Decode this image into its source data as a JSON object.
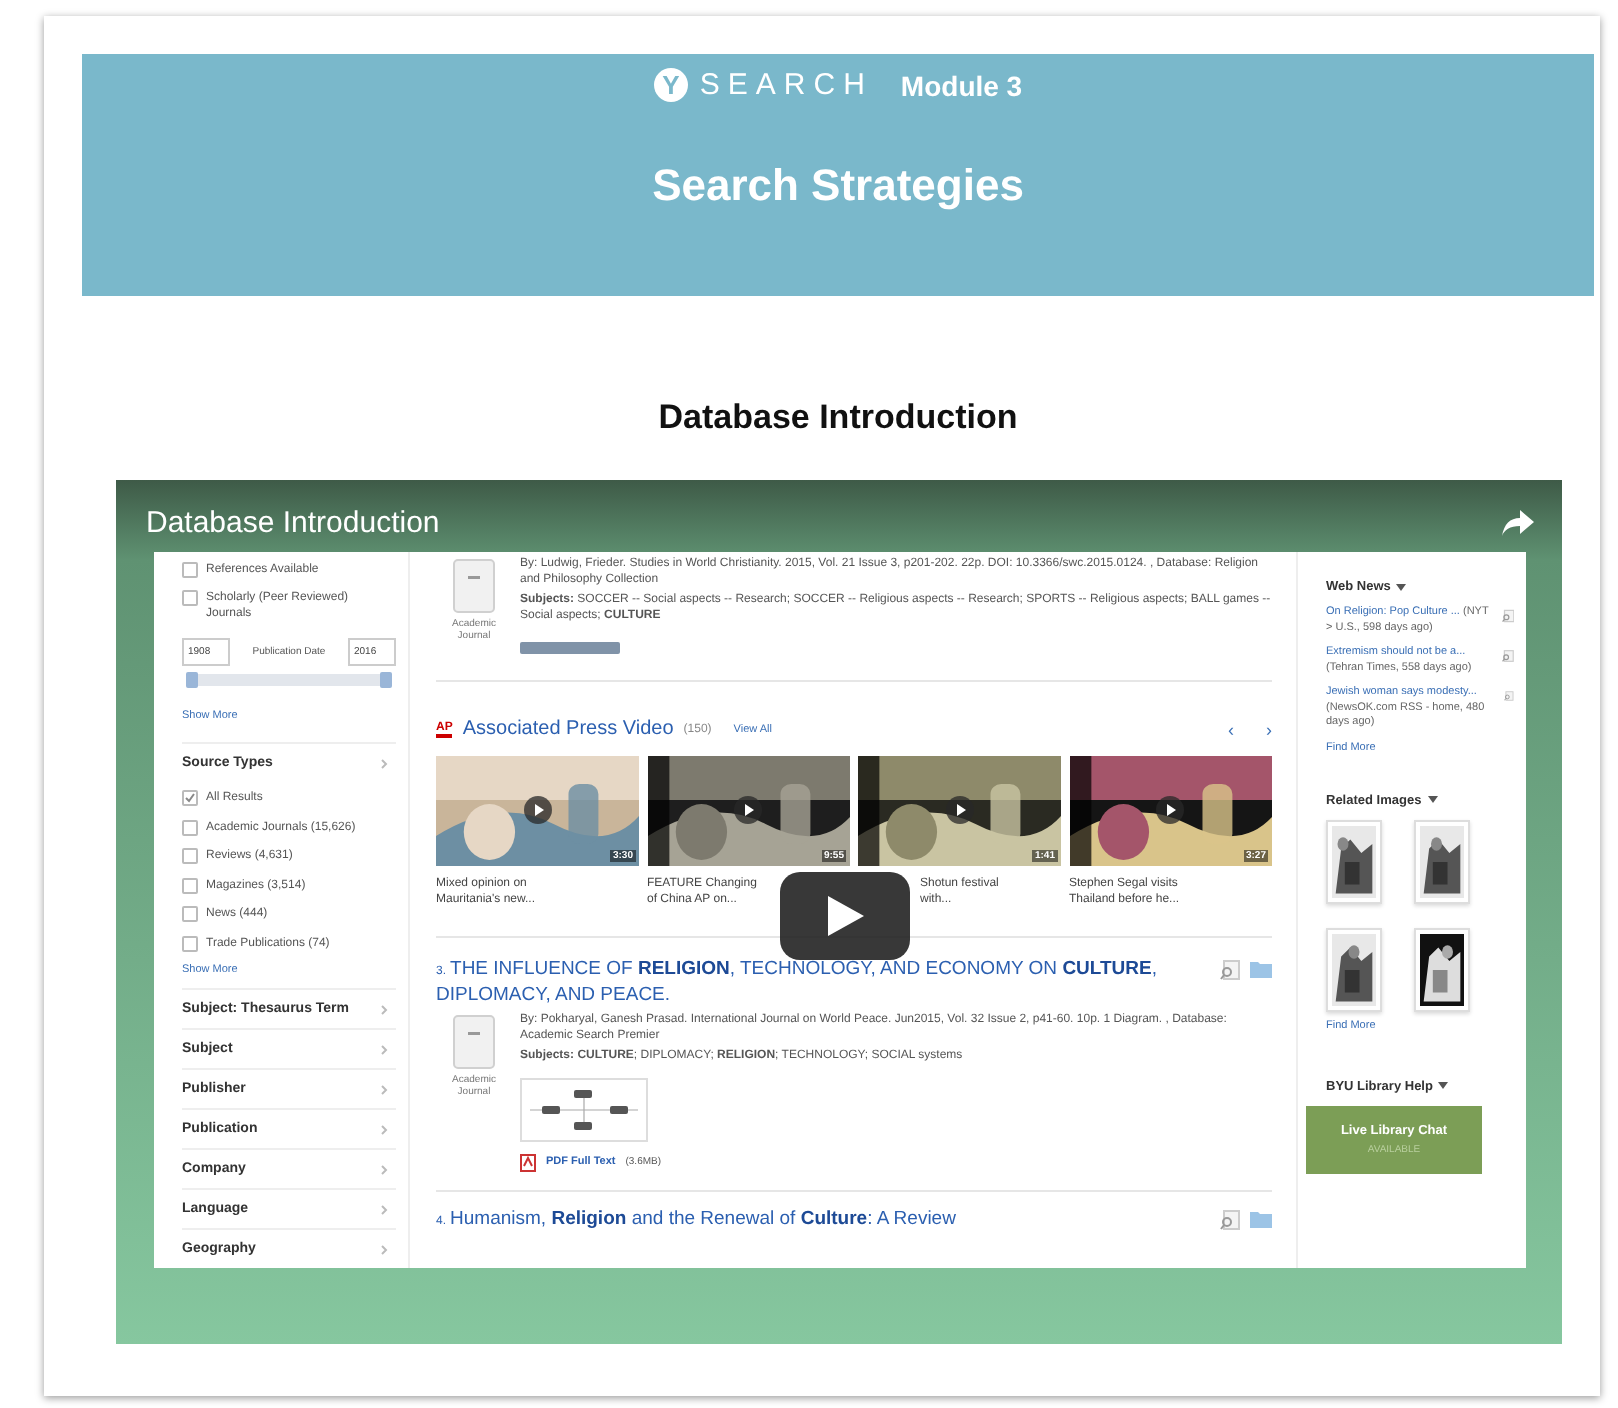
{
  "header": {
    "logo_letter": "Y",
    "brand": "SEARCH",
    "module": "Module 3",
    "title": "Search Strategies"
  },
  "section_heading": "Database Introduction",
  "video": {
    "title": "Database Introduction",
    "screen": {
      "sidebar": {
        "limiters": [
          {
            "label": "References Available",
            "checked": false
          },
          {
            "label": "Scholarly (Peer Reviewed) Journals",
            "checked": false
          }
        ],
        "date": {
          "from": "1908",
          "label": "Publication Date",
          "to": "2016",
          "slider": {
            "level": 1
          }
        },
        "show_more": "Show More",
        "source_types": {
          "title": "Source Types",
          "items": [
            {
              "label": "All Results",
              "checked": true
            },
            {
              "label": "Academic Journals (15,626)",
              "checked": false
            },
            {
              "label": "Reviews (4,631)",
              "checked": false
            },
            {
              "label": "Magazines (3,514)",
              "checked": false
            },
            {
              "label": "News (444)",
              "checked": false
            },
            {
              "label": "Trade Publications (74)",
              "checked": false
            }
          ],
          "show_more": "Show More"
        },
        "facets": [
          "Subject: Thesaurus Term",
          "Subject",
          "Publisher",
          "Publication",
          "Company",
          "Language",
          "Geography"
        ]
      },
      "previous_result": {
        "type_label": "Academic Journal",
        "meta": "By: Ludwig, Frieder. Studies in World Christianity. 2015, Vol. 21 Issue 3, p201-202. 22p. DOI: 10.3366/swc.2015.0124. , Database: Religion and Philosophy Collection",
        "subjects": "**Subjects:** SOCCER -- Social aspects -- Research; SOCCER -- Religious aspects -- Research; SPORTS -- Religious aspects; BALL games -- Social aspects; **CULTURE**"
      },
      "ap_video": {
        "logo": "AP",
        "title": "Associated Press Video",
        "count": "(150)",
        "view_all": "View All",
        "prev": "‹",
        "next": "›",
        "videos": [
          {
            "duration": "3:30",
            "caption": [
              "Mixed opinion on",
              "Mauritania's new..."
            ],
            "partly_hidden": false
          },
          {
            "duration": "9:55",
            "caption": [
              "FEATURE Changing",
              "of China AP on..."
            ],
            "partly_hidden": false
          },
          {
            "duration": "1:41",
            "caption": [
              "Shotun festival",
              "with..."
            ],
            "partly_hidden": true
          },
          {
            "duration": "3:27",
            "caption": [
              "Stephen Segal visits",
              "Thailand before he..."
            ],
            "partly_hidden": false
          }
        ]
      },
      "results": [
        {
          "number": "3.",
          "title": "THE INFLUENCE OF **RELIGION**, TECHNOLOGY, AND ECONOMY ON **CULTURE**, DIPLOMACY, AND PEACE.",
          "type_label": "Academic Journal",
          "meta": "By: Pokharyal, Ganesh Prasad. International Journal on World Peace. Jun2015, Vol. 32 Issue 2, p41-60. 10p. 1 Diagram. , Database: Academic Search Premier",
          "subjects": "**Subjects:** **CULTURE**; DIPLOMACY; **RELIGION**; TECHNOLOGY; SOCIAL systems",
          "pdf": "PDF Full Text",
          "pdf_size": "(3.6MB)"
        },
        {
          "number": "4.",
          "title": "Humanism, **Religion** and the Renewal of **Culture**: A Review"
        }
      ],
      "right": {
        "web_news": {
          "title": "Web News",
          "items": [
            {
              "link": "On Religion: Pop Culture ...",
              "source": "(NYT > U.S., 598 days ago)"
            },
            {
              "link": "Extremism should not be a...",
              "source": "(Tehran Times, 558 days ago)"
            },
            {
              "link": "Jewish woman says modesty...",
              "source": "(NewsOK.com RSS - home, 480 days ago)"
            }
          ],
          "find_more": "Find More"
        },
        "related_images": {
          "title": "Related Images",
          "find_more": "Find More"
        },
        "help": {
          "title": "BYU Library Help",
          "chat": "Live Library Chat",
          "status": "AVAILABLE"
        }
      }
    }
  }
}
